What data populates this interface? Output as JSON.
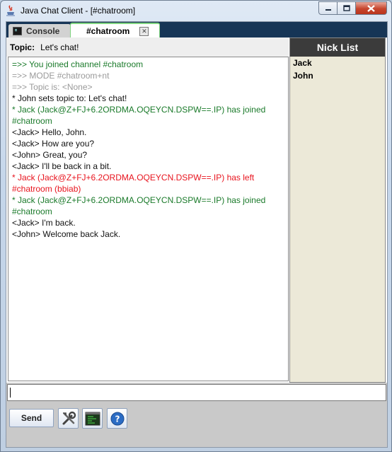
{
  "window": {
    "title": "Java Chat Client - [#chatroom]"
  },
  "tabs": [
    {
      "label": "Console"
    },
    {
      "label": "#chatroom"
    }
  ],
  "topic": {
    "label": "Topic:",
    "value": "Let's chat!"
  },
  "messages": [
    {
      "text": "=>> You joined channel #chatroom",
      "kind": "green"
    },
    {
      "text": "=>> MODE #chatroom+nt",
      "kind": "gray"
    },
    {
      "text": "=>> Topic is: <None>",
      "kind": "gray"
    },
    {
      "text": "* John sets topic to: Let's chat!",
      "kind": "black"
    },
    {
      "text": "* Jack (Jack@Z+FJ+6.2ORDMA.OQEYCN.DSPW==.IP) has joined",
      "kind": "green"
    },
    {
      "text": "#chatroom",
      "kind": "green"
    },
    {
      "text": "<Jack> Hello, John.",
      "kind": "black"
    },
    {
      "text": "<Jack> How are you?",
      "kind": "black"
    },
    {
      "text": "<John> Great, you?",
      "kind": "black"
    },
    {
      "text": "<Jack> I'll be back in a bit.",
      "kind": "black"
    },
    {
      "text": "* Jack (Jack@Z+FJ+6.2ORDMA.OQEYCN.DSPW==.IP) has left",
      "kind": "red"
    },
    {
      "text": "#chatroom (bbiab)",
      "kind": "red"
    },
    {
      "text": "* Jack (Jack@Z+FJ+6.2ORDMA.OQEYCN.DSPW==.IP) has joined",
      "kind": "green"
    },
    {
      "text": "#chatroom",
      "kind": "green"
    },
    {
      "text": "<Jack> I'm back.",
      "kind": "black"
    },
    {
      "text": "<John> Welcome back Jack.",
      "kind": "black"
    }
  ],
  "nicklist": {
    "title": "Nick List",
    "nicks": [
      "Jack",
      "John"
    ]
  },
  "input": {
    "value": ""
  },
  "toolbar": {
    "send_label": "Send",
    "icons": [
      "settings-tools-icon",
      "terminal-icon",
      "help-icon"
    ]
  },
  "colors": {
    "green": "#1a7a2a",
    "gray": "#9a9a9a",
    "red": "#e8141e",
    "tab_bar": "#163556"
  }
}
